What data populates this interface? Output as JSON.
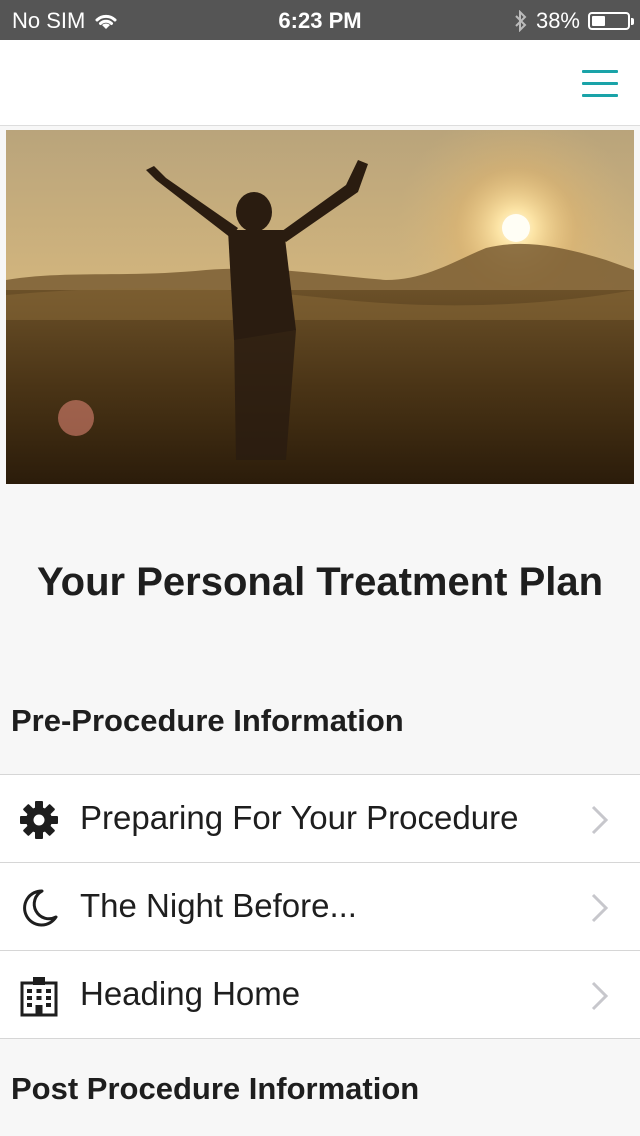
{
  "status_bar": {
    "carrier": "No SIM",
    "time": "6:23 PM",
    "battery_percent_label": "38%",
    "battery_level": 0.38
  },
  "navbar": {
    "menu_icon": "hamburger-icon",
    "accent_color": "#1aa3a8"
  },
  "hero": {
    "image": "person-arms-raised-in-wheat-field-at-sunset"
  },
  "page_title": "Your Personal Treatment Plan",
  "sections": {
    "pre": {
      "title": "Pre-Procedure Information",
      "items": [
        {
          "label": "Preparing For Your Procedure",
          "icon": "gear-icon"
        },
        {
          "label": "The Night Before...",
          "icon": "moon-icon"
        },
        {
          "label": "Heading Home",
          "icon": "building-icon"
        }
      ]
    },
    "post": {
      "title": "Post Procedure Information"
    }
  }
}
